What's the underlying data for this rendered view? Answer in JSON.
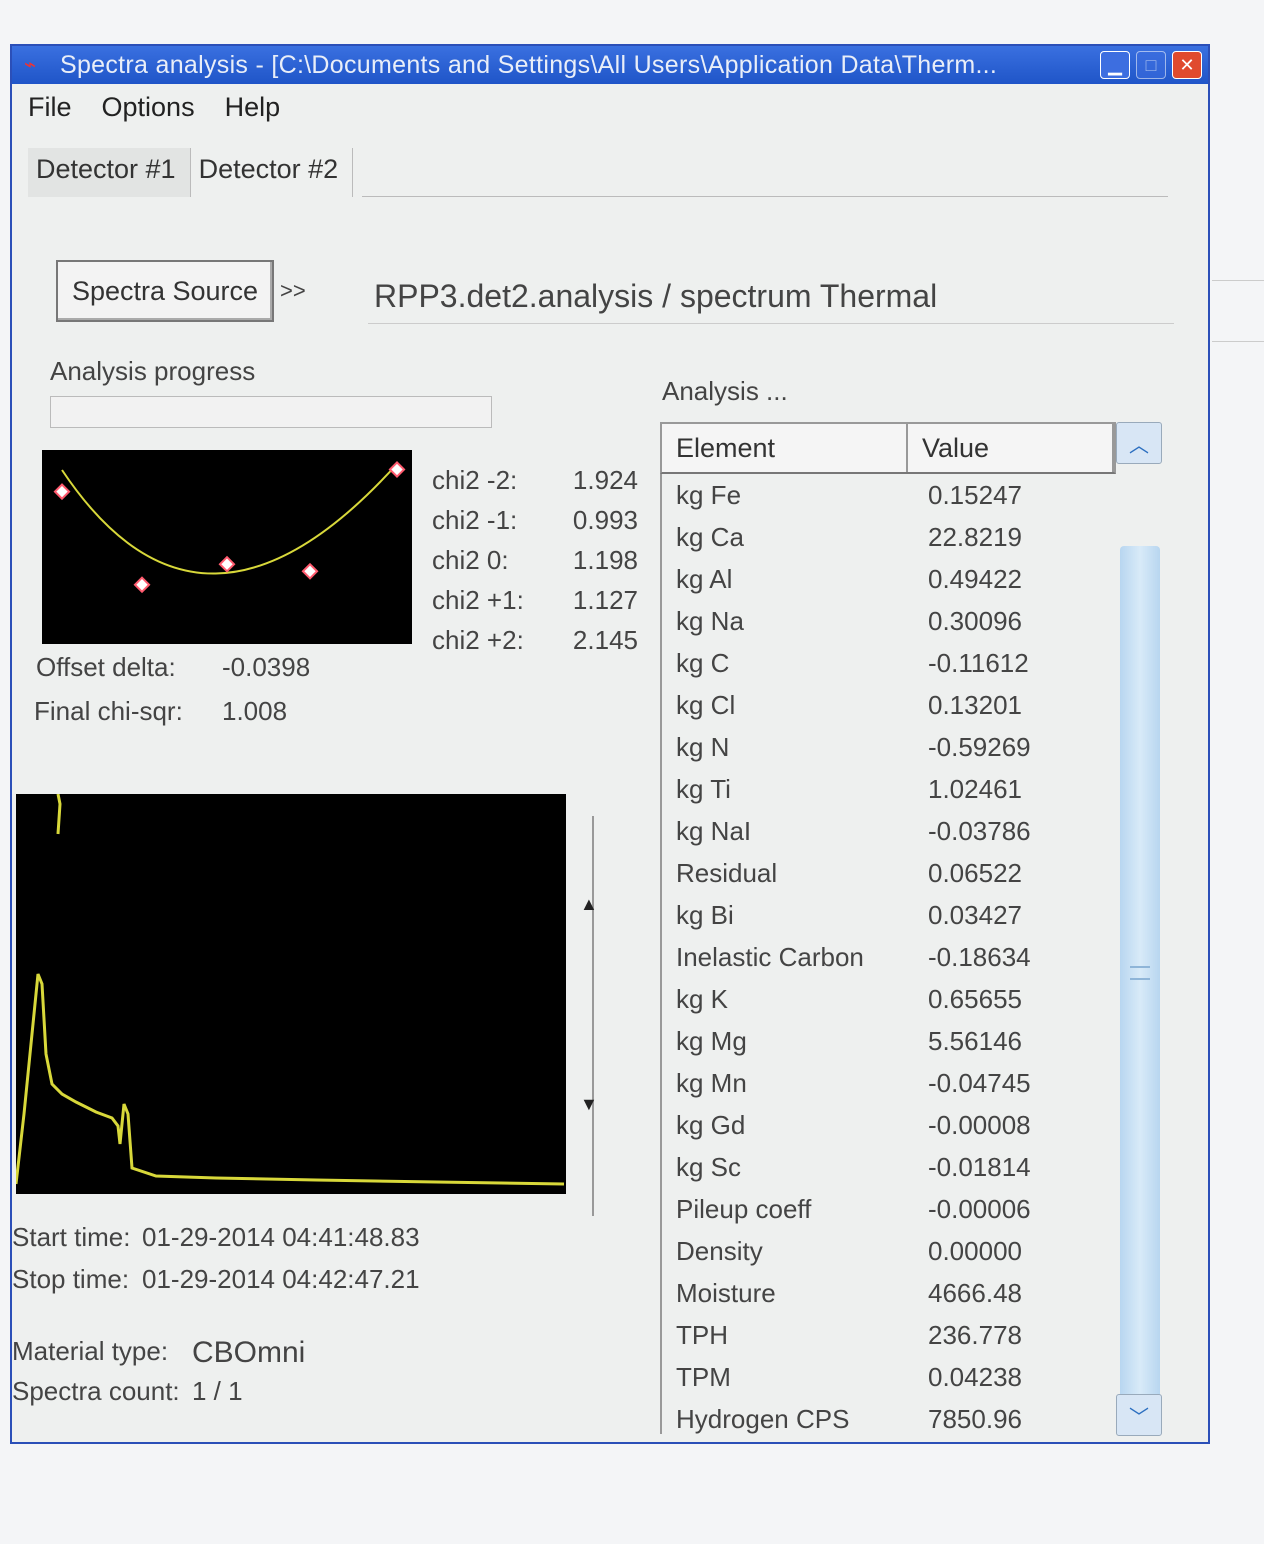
{
  "window": {
    "title": "Spectra analysis - [C:\\Documents and Settings\\All Users\\Application Data\\Therm..."
  },
  "menu": [
    "File",
    "Options",
    "Help"
  ],
  "tabs": [
    "Detector #1",
    "Detector #2"
  ],
  "source": {
    "button_label": "Spectra Source",
    "arrow": ">>",
    "value": "RPP3.det2.analysis / spectrum Thermal"
  },
  "progress": {
    "label": "Analysis progress"
  },
  "chi": [
    {
      "label": "chi2 -2:",
      "value": "1.924"
    },
    {
      "label": "chi2 -1:",
      "value": "0.993"
    },
    {
      "label": "chi2  0:",
      "value": "1.198"
    },
    {
      "label": "chi2 +1:",
      "value": "1.127"
    },
    {
      "label": "chi2 +2:",
      "value": "2.145"
    }
  ],
  "fit": {
    "offset_label": "Offset delta:",
    "offset_value": "-0.0398",
    "final_label": "Final chi-sqr:",
    "final_value": "1.008"
  },
  "times": {
    "start_label": "Start time:",
    "start_value": "01-29-2014  04:41:48.83",
    "stop_label": "Stop time:",
    "stop_value": "01-29-2014  04:42:47.21"
  },
  "material": {
    "type_label": "Material type:",
    "type_value": "CBOmni",
    "count_label": "Spectra count:",
    "count_value": "1 / 1"
  },
  "analysis": {
    "label": "Analysis ...",
    "col_element": "Element",
    "col_value": "Value",
    "rows": [
      {
        "element": "kg Fe",
        "value": "0.15247"
      },
      {
        "element": "kg Ca",
        "value": "22.8219"
      },
      {
        "element": "kg Al",
        "value": "0.49422"
      },
      {
        "element": "kg Na",
        "value": "0.30096"
      },
      {
        "element": "kg C",
        "value": "-0.11612"
      },
      {
        "element": "kg Cl",
        "value": "0.13201"
      },
      {
        "element": "kg N",
        "value": "-0.59269"
      },
      {
        "element": "kg Ti",
        "value": "1.02461"
      },
      {
        "element": "kg NaI",
        "value": "-0.03786"
      },
      {
        "element": "Residual",
        "value": "0.06522"
      },
      {
        "element": "kg Bi",
        "value": "0.03427"
      },
      {
        "element": "Inelastic Carbon",
        "value": "-0.18634"
      },
      {
        "element": "kg K",
        "value": "0.65655"
      },
      {
        "element": "kg Mg",
        "value": "5.56146"
      },
      {
        "element": "kg Mn",
        "value": "-0.04745"
      },
      {
        "element": "kg Gd",
        "value": "-0.00008"
      },
      {
        "element": "kg Sc",
        "value": "-0.01814"
      },
      {
        "element": "Pileup coeff",
        "value": "-0.00006"
      },
      {
        "element": "Density",
        "value": "0.00000"
      },
      {
        "element": "Moisture",
        "value": "4666.48"
      },
      {
        "element": "TPH",
        "value": "236.778"
      },
      {
        "element": "TPM",
        "value": "0.04238"
      },
      {
        "element": "Hydrogen CPS",
        "value": "7850.96"
      }
    ]
  },
  "icons": {
    "app": "app-spectrum-icon",
    "minimize": "minimize-icon",
    "maximize": "maximize-icon",
    "close": "close-icon",
    "scroll_up": "chevron-up-icon",
    "scroll_down": "chevron-down-icon"
  },
  "colors": {
    "titlebar": "#1f55c8",
    "plot_bg": "#000000",
    "curve": "#d8d83a",
    "marker": "#ff5a6e",
    "close_button": "#e04a2e"
  },
  "chi_plot": {
    "points": [
      -2,
      -1,
      0,
      1,
      2
    ],
    "chi2": [
      1.924,
      0.993,
      1.198,
      1.127,
      2.145
    ]
  }
}
